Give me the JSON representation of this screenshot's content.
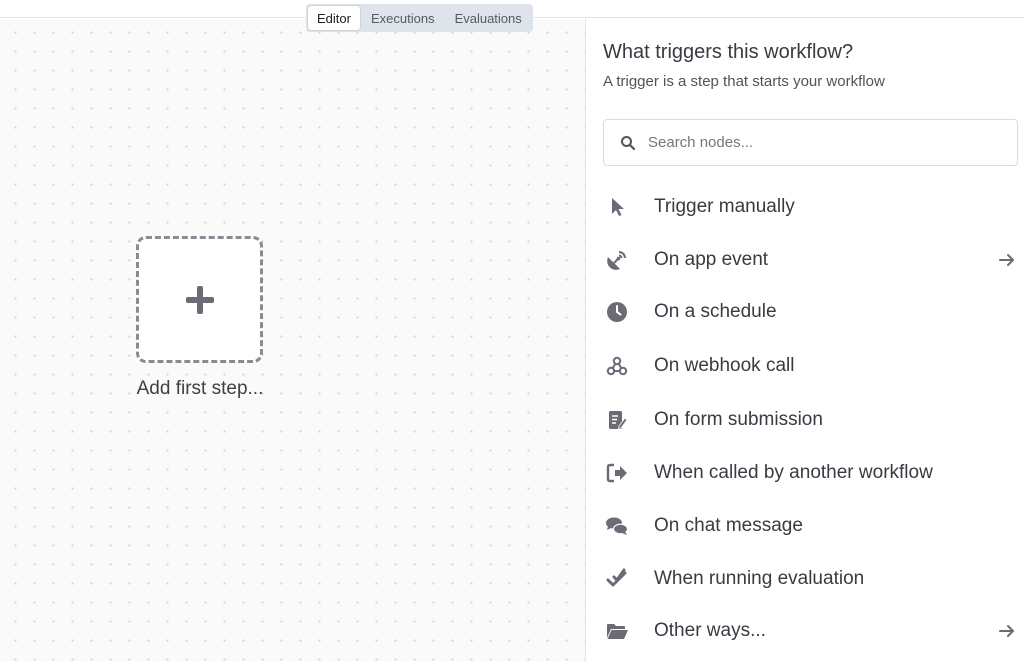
{
  "tabs": [
    {
      "label": "Editor",
      "active": true
    },
    {
      "label": "Executions",
      "active": false
    },
    {
      "label": "Evaluations",
      "active": false
    }
  ],
  "canvas": {
    "add_first_step_label": "Add first step..."
  },
  "panel": {
    "title": "What triggers this workflow?",
    "subtitle": "A trigger is a step that starts your workflow",
    "search": {
      "placeholder": "Search nodes...",
      "value": ""
    },
    "triggers": [
      {
        "label": "Trigger manually",
        "icon": "cursor-pointer-icon",
        "has_arrow": false
      },
      {
        "label": "On app event",
        "icon": "satellite-dish-icon",
        "has_arrow": true
      },
      {
        "label": "On a schedule",
        "icon": "clock-icon",
        "has_arrow": false
      },
      {
        "label": "On webhook call",
        "icon": "webhook-icon",
        "has_arrow": false
      },
      {
        "label": "On form submission",
        "icon": "form-edit-icon",
        "has_arrow": false
      },
      {
        "label": "When called by another workflow",
        "icon": "sign-in-arrow-icon",
        "has_arrow": false
      },
      {
        "label": "On chat message",
        "icon": "chat-bubbles-icon",
        "has_arrow": false
      },
      {
        "label": "When running evaluation",
        "icon": "double-check-icon",
        "has_arrow": false
      },
      {
        "label": "Other ways...",
        "icon": "folder-open-icon",
        "has_arrow": true
      }
    ]
  },
  "colors": {
    "icon_gray": "#6b6b75",
    "text_dark": "#3a3a42",
    "tab_bar_bg": "#dfe3ea"
  }
}
